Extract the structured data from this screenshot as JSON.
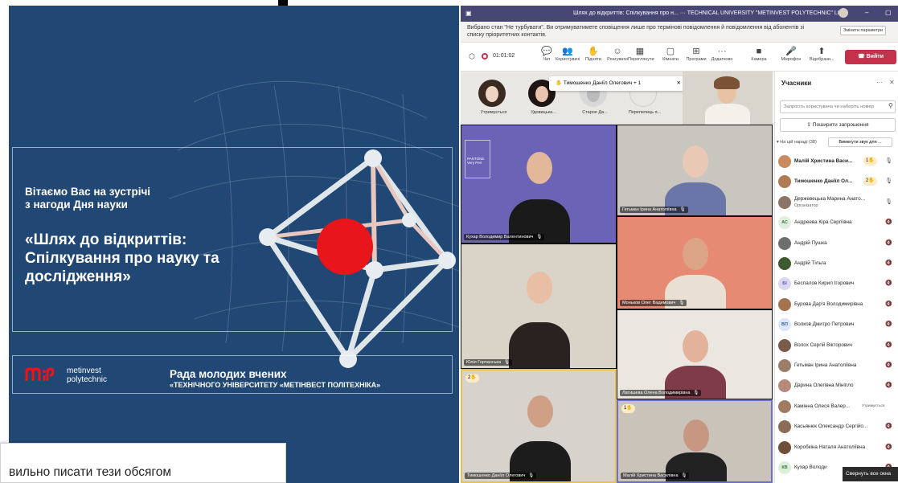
{
  "slide": {
    "greeting_line1": "Вітаємо Вас на зустрічі",
    "greeting_line2": "з нагоди Дня науки",
    "title_line1": "«Шлях до відкриттів:",
    "title_line2": "Спілкування про науку та",
    "title_line3": "дослідження»",
    "logo_line1": "metinvest",
    "logo_line2": "polytechnic",
    "council": "Рада молодих вчених",
    "university": "«ТЕХНІЧНОГО УНІВЕРСИТЕТУ «МЕТІНВЕСТ ПОЛІТЕХНІКА»"
  },
  "document": {
    "text": "вильно писати тези обсягом"
  },
  "teams": {
    "window_title": "Шлях до відкриттів: Спілкування про н...  ···  TECHNICAL UNIVERSITY \"METINVEST POLYTECHNIC\" LLC",
    "notice": "Вибрано стан \"Не турбувати\". Ви отримуватимете сповіщення лише про термінові повідомлення й повідомлення від абонентів зі списку пріоритетних контактів.",
    "change_settings": "Змінити параметри",
    "timer": "01:01:02",
    "toolbar": [
      {
        "icon": "💬",
        "label": "Чат"
      },
      {
        "icon": "👥",
        "label": "Користувачі"
      },
      {
        "icon": "✋",
        "label": "Підняти"
      },
      {
        "icon": "☺",
        "label": "Реагувати"
      },
      {
        "icon": "▦",
        "label": "Переглянути"
      },
      {
        "icon": "▢",
        "label": "Кімнати"
      },
      {
        "icon": "⊞",
        "label": "Програми"
      },
      {
        "icon": "···",
        "label": "Додатково"
      },
      {
        "icon": "■",
        "label": "Камера"
      },
      {
        "icon": "🎤",
        "label": "Мікрофон"
      },
      {
        "icon": "⬆",
        "label": "Відобрази..."
      }
    ],
    "leave": "Вийти",
    "popup": "Тимошенко Даніїл Олегович + 1",
    "strip": [
      {
        "name": "Утримується"
      },
      {
        "name": "Удовицька..."
      },
      {
        "name": "Старое Да..."
      },
      {
        "name": "Перепелиць я..."
      }
    ],
    "tiles": [
      {
        "name": "Кухар Володимир Валентинович",
        "pantone_title": "PANTONE",
        "pantone_sub": "Very Peri"
      },
      {
        "name": "Гетьман Ірина Анатоліївна"
      },
      {
        "name": "Моньков Олег Вадимович"
      },
      {
        "name": "Юлія Горчанська"
      },
      {
        "name": "Латишева Олена Володимирівна"
      },
      {
        "name": "Тимошенко Даніїл Олегович",
        "hand": "2✋"
      },
      {
        "name": "Малій Христина Василівна",
        "hand": "1✋"
      }
    ],
    "panel": {
      "title": "Учасники",
      "search_placeholder": "Запросіть користувача чи наберіть номер",
      "share": "Поширити запрошення",
      "in_meeting": "На цій нараді (38)",
      "mute_all": "Вимкнути звук для ...",
      "collapse": "Свернуть все окна",
      "participants": [
        {
          "name": "Малій Христина Васи...",
          "initials": "",
          "hand": "1✋"
        },
        {
          "name": "Тимошенко Даніїл Ол...",
          "initials": "",
          "hand": "2✋"
        },
        {
          "name": "Держевецька Марина Анато...",
          "initials": "",
          "sub": "Організатор"
        },
        {
          "name": "Андреева Кіра Сергіївна",
          "initials": "АС"
        },
        {
          "name": "Андрій Пушка",
          "initials": ""
        },
        {
          "name": "Андрій Тільга",
          "initials": ""
        },
        {
          "name": "Беспалов Кирил Ігорович",
          "initials": "БІ"
        },
        {
          "name": "Бурова Дар'я Володимирівна",
          "initials": ""
        },
        {
          "name": "Волков Дмитро Петрович",
          "initials": "ВП"
        },
        {
          "name": "Волох Сергій Вікторович",
          "initials": ""
        },
        {
          "name": "Гетьман Ірина Анатоліївна",
          "initials": ""
        },
        {
          "name": "Дарина Олегівна Мініпло",
          "initials": ""
        },
        {
          "name": "Камінна Олеся Валер...",
          "initials": "",
          "status": "Утримується"
        },
        {
          "name": "Касьянюк Олександр Сергійо...",
          "initials": ""
        },
        {
          "name": "Коробкіна Наталя Анатоліївна",
          "initials": ""
        },
        {
          "name": "Кухар Володи",
          "initials": "КВ"
        }
      ]
    }
  }
}
